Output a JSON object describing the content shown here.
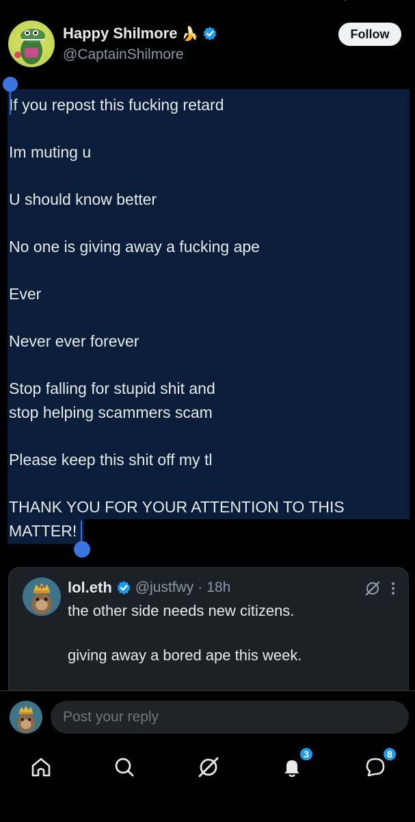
{
  "colors": {
    "background": "#000000",
    "selection": "#0a1e3b",
    "selection_handle": "#3b74e0",
    "verified": "#1d9bf0",
    "muted_text": "#8b98a5",
    "quote_bg": "#1c2127"
  },
  "header": {
    "display_name": "Happy Shilmore",
    "emoji": "🍌",
    "handle": "@CaptainShilmore",
    "follow_label": "Follow",
    "verified_icon": "verified-badge-icon"
  },
  "tweet": {
    "lines": [
      "If you repost this fucking retard",
      "Im muting u",
      "U should know better",
      "No one is giving away a fucking ape",
      "Ever",
      "Never ever forever",
      "Stop falling for stupid shit and",
      "stop helping scammers scam",
      "Please keep this shit off my tl",
      "THANK YOU FOR YOUR ATTENTION TO THIS",
      "MATTER!"
    ]
  },
  "quote": {
    "display_name": "lol.eth",
    "handle": "@justfwy",
    "separator": "·",
    "time": "18h",
    "line1": "the other side needs new citizens.",
    "line2": "giving away a bored ape this week."
  },
  "reply": {
    "placeholder": "Post your reply"
  },
  "nav": {
    "notifications_badge": "3",
    "messages_badge": "8"
  }
}
